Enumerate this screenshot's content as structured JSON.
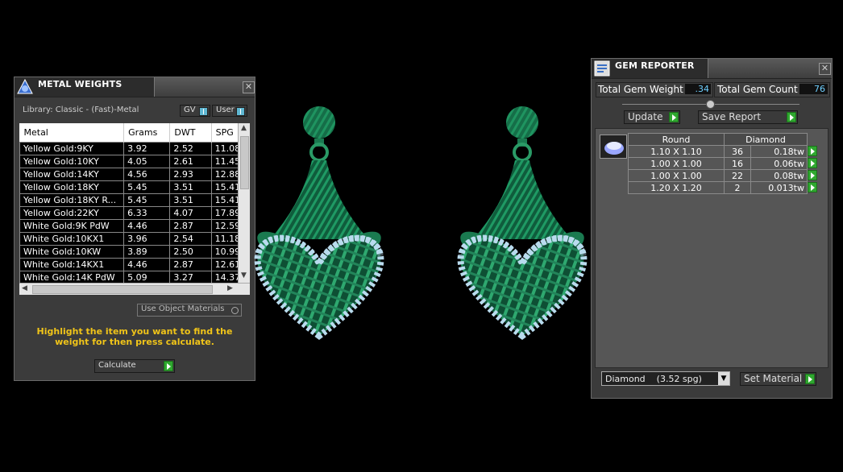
{
  "metal_panel": {
    "title": "METAL WEIGHTS",
    "library": "Library: Classic - (Fast)-Metal",
    "gv_label": "GV",
    "user_label": "User",
    "columns": [
      "Metal",
      "Grams",
      "DWT",
      "SPG"
    ],
    "rows": [
      [
        "Yellow Gold:9KY",
        "3.92",
        "2.52",
        "11.08"
      ],
      [
        "Yellow Gold:10KY",
        "4.05",
        "2.61",
        "11.45"
      ],
      [
        "Yellow Gold:14KY",
        "4.56",
        "2.93",
        "12.88"
      ],
      [
        "Yellow Gold:18KY",
        "5.45",
        "3.51",
        "15.41"
      ],
      [
        "Yellow Gold:18KY R...",
        "5.45",
        "3.51",
        "15.41"
      ],
      [
        "Yellow Gold:22KY",
        "6.33",
        "4.07",
        "17.89"
      ],
      [
        "White Gold:9K PdW",
        "4.46",
        "2.87",
        "12.59"
      ],
      [
        "White Gold:10KX1",
        "3.96",
        "2.54",
        "11.18"
      ],
      [
        "White Gold:10KW",
        "3.89",
        "2.50",
        "10.99"
      ],
      [
        "White Gold:14KX1",
        "4.46",
        "2.87",
        "12.61"
      ],
      [
        "White Gold:14K PdW",
        "5.09",
        "3.27",
        "14.37"
      ]
    ],
    "use_object_materials": "Use Object Materials",
    "instruction": "Highlight the item you want to find the weight for then press calculate.",
    "calculate_label": "Calculate"
  },
  "gem_panel": {
    "title": "GEM REPORTER",
    "total_gem_weight_label": "Total Gem Weight",
    "total_gem_weight": ".34",
    "total_gem_count_label": "Total Gem Count",
    "total_gem_count": "76",
    "update_label": "Update",
    "save_report_label": "Save Report",
    "shape": "Round",
    "stone": "Diamond",
    "rows": [
      [
        "1.10 X 1.10",
        "36",
        "0.18tw"
      ],
      [
        "1.00 X 1.00",
        "16",
        "0.06tw"
      ],
      [
        "1.00 X 1.00",
        "22",
        "0.08tw"
      ],
      [
        "1.20 X 1.20",
        "2",
        "0.013tw"
      ]
    ],
    "material_select": "Diamond    (3.52 spg)",
    "set_material_label": "Set Material"
  },
  "colors": {
    "accent_green": "#2fa82f",
    "wax_green": "#1f8a5a",
    "gem_blue": "#b9dbee",
    "instruction_yellow": "#f0c419"
  }
}
